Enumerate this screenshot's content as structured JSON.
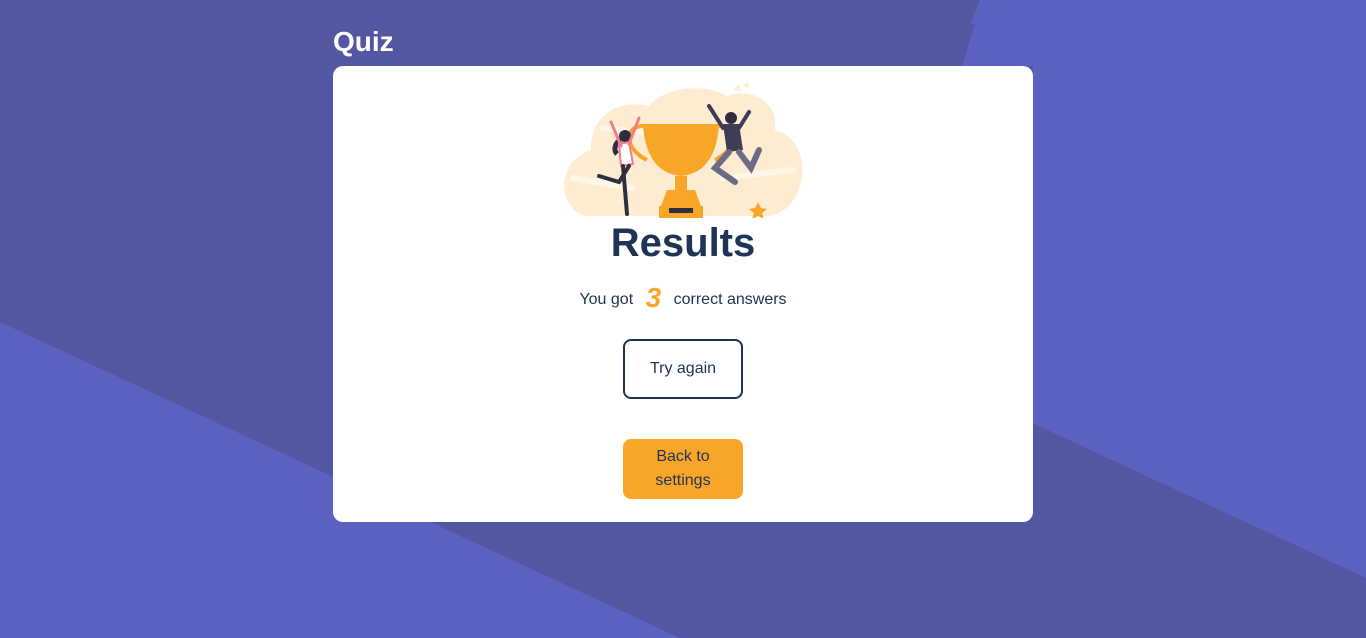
{
  "app": {
    "title": "Quiz"
  },
  "results": {
    "heading": "Results",
    "prefix": "You got",
    "score": "3",
    "suffix": "correct answers",
    "illustration": "trophy-celebration-illustration"
  },
  "actions": {
    "try_again_label": "Try again",
    "back_label": "Back to settings"
  },
  "colors": {
    "background": "#5356a0",
    "background_accent": "#5d61c2",
    "card": "#ffffff",
    "text_dark": "#1e3356",
    "accent_orange": "#f8a627"
  }
}
